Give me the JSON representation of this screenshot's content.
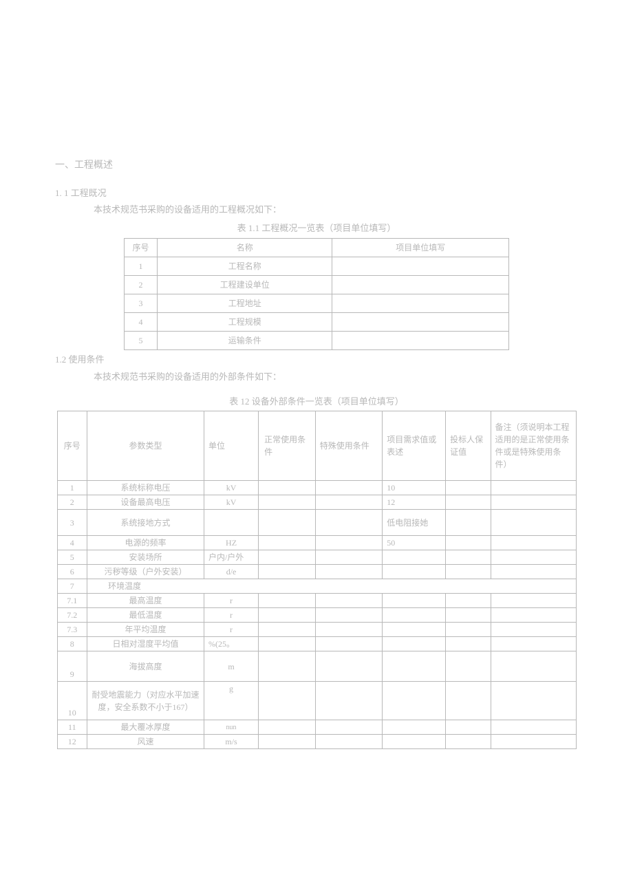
{
  "section1": {
    "title": "一、工程概述",
    "sub1_label": "1.    1 工程既况",
    "sub1_text": "本技术规范书采购的设备适用的工程概况如下：",
    "table1_caption": "表 1.1 工程概况一览表（项目单位填写）",
    "table1_headers": [
      "序号",
      "名称",
      "项目单位填写"
    ],
    "table1_rows": [
      {
        "idx": "1",
        "name": "工程名称",
        "val": ""
      },
      {
        "idx": "2",
        "name": "工程建设单位",
        "val": ""
      },
      {
        "idx": "3",
        "name": "工程地址",
        "val": ""
      },
      {
        "idx": "4",
        "name": "工程规模",
        "val": ""
      },
      {
        "idx": "5",
        "name": "运输条件",
        "val": ""
      }
    ],
    "sub2_label": "1.2 使用条件",
    "sub2_text": "本技术规范书采购的设备适用的外部条件如下：",
    "table2_caption": "表 12 设备外部条件一览表（项目单位填写）",
    "table2_headers": {
      "h0": "序号",
      "h1": "参数类型",
      "h2": "单位",
      "h3": "正常使用条件",
      "h4": "特殊使用条件",
      "h5": "项目需求值或表述",
      "h6": "投标人保证值",
      "h7": "备注（须说明本工程适用的是正常使用条件或是特殊使用条件）"
    },
    "table2_rows": [
      {
        "idx": "1",
        "name": "系统标称电压",
        "unit": "kV",
        "c3": "",
        "c4": "",
        "c5": "10",
        "c6": "",
        "c7": ""
      },
      {
        "idx": "2",
        "name": "设备最高电压",
        "unit": "kV",
        "c3": "",
        "c4": "",
        "c5": "12",
        "c6": "",
        "c7": ""
      },
      {
        "idx": "3",
        "name": "系统接地方式",
        "unit": "",
        "c3": "",
        "c4": "",
        "c5": "低电阻接她",
        "c6": "",
        "c7": ""
      },
      {
        "idx": "4",
        "name": "电源的频率",
        "unit": "HZ",
        "c3": "",
        "c4": "",
        "c5": "50",
        "c6": "",
        "c7": ""
      },
      {
        "idx": "5",
        "name": "安装场所",
        "unit": "户内/户外",
        "c3": "",
        "c4": "",
        "c5": "",
        "c6": "",
        "c7": ""
      },
      {
        "idx": "6",
        "name": "污秽等级（户外安装）",
        "unit": "d/e",
        "c3": "",
        "c4": "",
        "c5": "",
        "c6": "",
        "c7": ""
      },
      {
        "idx": "7",
        "name": "环境温度",
        "span": true
      },
      {
        "idx": "7.1",
        "name": "最高温度",
        "unit": "r",
        "c3": "",
        "c4": "",
        "c5": "",
        "c6": "",
        "c7": ""
      },
      {
        "idx": "7.2",
        "name": "最低温度",
        "unit": "r",
        "c3": "",
        "c4": "",
        "c5": "",
        "c6": "",
        "c7": ""
      },
      {
        "idx": "7.3",
        "name": "年平均温度",
        "unit": "r",
        "c3": "",
        "c4": "",
        "c5": "",
        "c6": "",
        "c7": ""
      },
      {
        "idx": "8",
        "name": "日相对湿度平均值",
        "unit": "%(25。",
        "c3": "",
        "c4": "",
        "c5": "",
        "c6": "",
        "c7": ""
      },
      {
        "idx": "9",
        "name": "海拔高度",
        "unit": "m",
        "c3": "",
        "c4": "",
        "c5": "",
        "c6": "",
        "c7": ""
      },
      {
        "idx": "10",
        "name": "耐受地震能力（对应水平加速度，安全系数不小于167）",
        "unit": "g",
        "c3": "",
        "c4": "",
        "c5": "",
        "c6": "",
        "c7": ""
      },
      {
        "idx": "11",
        "name": "最大覆冰厚度",
        "unit": "nun",
        "c3": "",
        "c4": "",
        "c5": "",
        "c6": "",
        "c7": ""
      },
      {
        "idx": "12",
        "name": "风速",
        "unit": "m/s",
        "c3": "",
        "c4": "",
        "c5": "",
        "c6": "",
        "c7": ""
      }
    ]
  }
}
